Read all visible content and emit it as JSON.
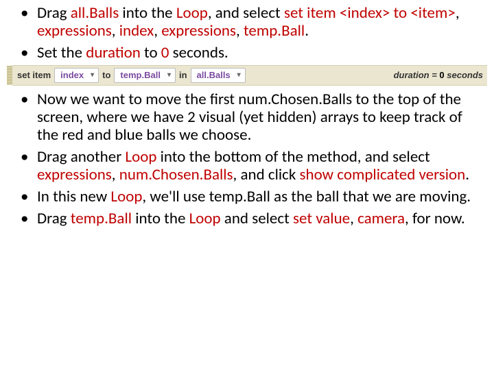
{
  "bullets_top": [
    {
      "segments": [
        {
          "t": "Drag "
        },
        {
          "t": "all.Balls",
          "red": 1
        },
        {
          "t": " into the "
        },
        {
          "t": "Loop",
          "red": 1
        },
        {
          "t": ", and select "
        },
        {
          "t": "set item <index> to <item>",
          "red": 1
        },
        {
          "t": ", "
        },
        {
          "t": "expressions",
          "red": 1
        },
        {
          "t": ", "
        },
        {
          "t": "index",
          "red": 1
        },
        {
          "t": ", "
        },
        {
          "t": "expressions",
          "red": 1
        },
        {
          "t": ", "
        },
        {
          "t": "temp.Ball",
          "red": 1
        },
        {
          "t": "."
        }
      ]
    },
    {
      "segments": [
        {
          "t": "Set the "
        },
        {
          "t": "duration",
          "red": 1
        },
        {
          "t": " to "
        },
        {
          "t": "0",
          "red": 1
        },
        {
          "t": " seconds."
        }
      ]
    }
  ],
  "code": {
    "set_item": "set item",
    "index_kw": "index",
    "to": "to",
    "item_kw": "temp.Ball",
    "in": "in",
    "arr_kw": "all.Balls",
    "duration_label": "duration = ",
    "duration_val": "0",
    "duration_unit": " seconds"
  },
  "bullets_bottom": [
    {
      "segments": [
        {
          "t": "Now we want to move the first num.Chosen.Balls to the top of the screen, where we have 2 visual (yet hidden) arrays to keep track of the red and blue balls we choose."
        }
      ]
    },
    {
      "segments": [
        {
          "t": "Drag another "
        },
        {
          "t": "Loop",
          "red": 1
        },
        {
          "t": " into the bottom of the method, and select "
        },
        {
          "t": "expressions",
          "red": 1
        },
        {
          "t": ", "
        },
        {
          "t": "num.Chosen.Balls",
          "red": 1
        },
        {
          "t": ", and click "
        },
        {
          "t": "show complicated version",
          "red": 1
        },
        {
          "t": "."
        }
      ]
    },
    {
      "segments": [
        {
          "t": "In this new "
        },
        {
          "t": "Loop",
          "red": 1
        },
        {
          "t": ", we'll use temp.Ball as the ball that we are moving."
        }
      ]
    },
    {
      "segments": [
        {
          "t": "Drag "
        },
        {
          "t": "temp.Ball",
          "red": 1
        },
        {
          "t": " into the "
        },
        {
          "t": "Loop",
          "red": 1
        },
        {
          "t": " and select "
        },
        {
          "t": "set value",
          "red": 1
        },
        {
          "t": ", "
        },
        {
          "t": "camera",
          "red": 1
        },
        {
          "t": ", for now."
        }
      ]
    }
  ]
}
